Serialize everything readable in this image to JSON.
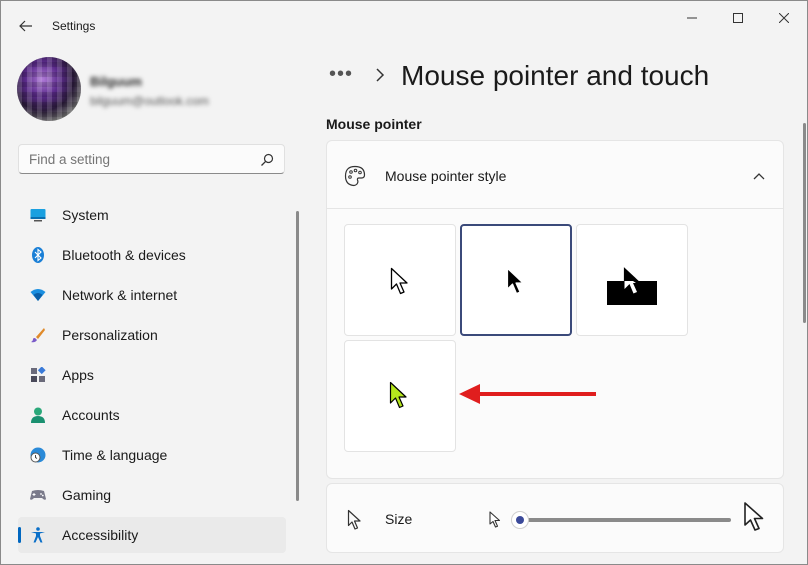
{
  "window": {
    "title": "Settings"
  },
  "profile": {
    "name": "Bilguum",
    "email": "bilguum@outlook.com"
  },
  "search": {
    "placeholder": "Find a setting"
  },
  "nav": {
    "items": [
      {
        "label": "System",
        "icon": "system-icon",
        "selected": false
      },
      {
        "label": "Bluetooth & devices",
        "icon": "bluetooth-icon",
        "selected": false
      },
      {
        "label": "Network & internet",
        "icon": "wifi-icon",
        "selected": false
      },
      {
        "label": "Personalization",
        "icon": "brush-icon",
        "selected": false
      },
      {
        "label": "Apps",
        "icon": "apps-icon",
        "selected": false
      },
      {
        "label": "Accounts",
        "icon": "person-icon",
        "selected": false
      },
      {
        "label": "Time & language",
        "icon": "clock-globe-icon",
        "selected": false
      },
      {
        "label": "Gaming",
        "icon": "gamepad-icon",
        "selected": false
      },
      {
        "label": "Accessibility",
        "icon": "accessibility-icon",
        "selected": true
      }
    ]
  },
  "header": {
    "breadcrumb_more": "•••",
    "page_title": "Mouse pointer and touch"
  },
  "section": {
    "title": "Mouse pointer"
  },
  "pointer_style": {
    "label": "Mouse pointer style",
    "expanded": true,
    "options": [
      {
        "name": "white",
        "selected": false
      },
      {
        "name": "black",
        "selected": true
      },
      {
        "name": "inverted",
        "selected": false
      },
      {
        "name": "custom",
        "selected": false,
        "color": "#b5e61d"
      }
    ]
  },
  "size": {
    "label": "Size",
    "value": 1
  },
  "colors": {
    "accent": "#0067c0",
    "annotation_arrow": "#e01e1e",
    "custom_pointer": "#b5e61d"
  }
}
